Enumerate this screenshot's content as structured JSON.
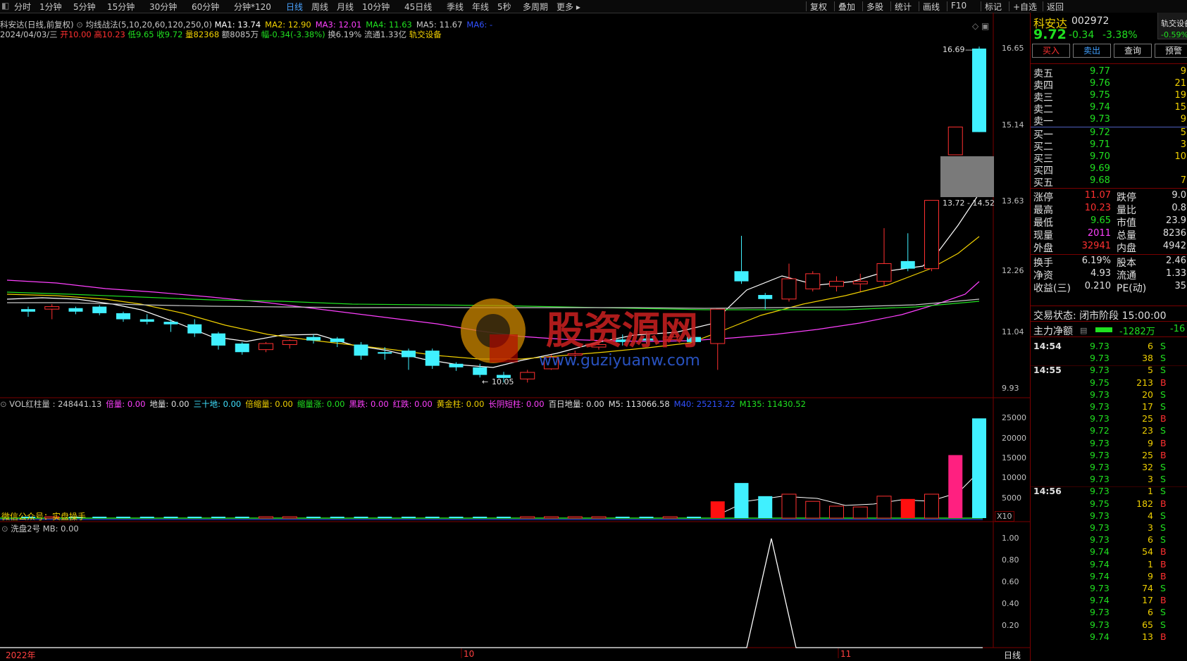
{
  "toolbar": {
    "tabs": [
      "分时",
      "1分钟",
      "5分钟",
      "15分钟",
      "30分钟",
      "60分钟",
      "分钟*120",
      "日线",
      "周线",
      "月线",
      "10分钟",
      "45日线",
      "季线",
      "年线",
      "5秒",
      "多周期",
      "更多 ▸"
    ],
    "active_tab": "日线",
    "right_buttons": [
      "复权",
      "叠加",
      "多股",
      "统计",
      "画线",
      "F10",
      "标记",
      "+自选",
      "返回"
    ]
  },
  "info": {
    "line1": {
      "stock": "科安达(日线,前复权)",
      "indicator": "均线战法(5,10,20,60,120,250,0)",
      "ma": [
        {
          "label": "MA1: 13.74",
          "color": "#ffffff"
        },
        {
          "label": "MA2: 12.90",
          "color": "#f0d000"
        },
        {
          "label": "MA3: 12.01",
          "color": "#ff40ff"
        },
        {
          "label": "MA4: 11.63",
          "color": "#20e020"
        },
        {
          "label": "MA5: 11.67",
          "color": "#c8c8c8"
        },
        {
          "label": "MA6: -",
          "color": "#3050ff"
        }
      ]
    },
    "line2": {
      "date": "2024/04/03/三",
      "open": "开10.00",
      "high": "高10.23",
      "low": "低9.65",
      "close": "收9.72",
      "vol": "量82368",
      "amount": "额8085万",
      "chg": "幅-0.34(-3.38%)",
      "turnover": "换6.19%",
      "float": "流通1.33亿",
      "sector": "轨交设备"
    }
  },
  "price_axis": [
    "16.65",
    "15.14",
    "13.63",
    "12.26",
    "11.04",
    "9.93"
  ],
  "price_notes": {
    "high_label": "16.69",
    "low_label": "10.05",
    "zone_label": "13.72 - 14.52"
  },
  "vol_header": [
    {
      "t": "VOL红柱量 : 248441.13",
      "c": "#c8c8c8"
    },
    {
      "t": "倍量: 0.00",
      "c": "#ff40ff"
    },
    {
      "t": "地量: 0.00",
      "c": "#e0e0e0"
    },
    {
      "t": "三十地: 0.00",
      "c": "#40e0ff"
    },
    {
      "t": "倍缩量: 0.00",
      "c": "#f0d000"
    },
    {
      "t": "缩量涨: 0.00",
      "c": "#20e020"
    },
    {
      "t": "黑跌: 0.00",
      "c": "#ff40ff"
    },
    {
      "t": "红跌: 0.00",
      "c": "#ff40ff"
    },
    {
      "t": "黄金柱: 0.00",
      "c": "#f0d000"
    },
    {
      "t": "长阴短柱: 0.00",
      "c": "#ff40ff"
    },
    {
      "t": "百日地量: 0.00",
      "c": "#e0e0e0"
    },
    {
      "t": "M5: 113066.58",
      "c": "#e0e0e0"
    },
    {
      "t": "M40: 25213.22",
      "c": "#3050ff"
    },
    {
      "t": "M135: 11430.52",
      "c": "#20e020"
    }
  ],
  "vol_axis": [
    "25000",
    "20000",
    "15000",
    "10000",
    "5000"
  ],
  "vol_unit": "X10",
  "vol_note": "微信公众号：实盘操手",
  "osc_header": "洗盘2号  MB: 0.00",
  "osc_axis": [
    "1.00",
    "0.80",
    "0.60",
    "0.40",
    "0.20"
  ],
  "time_axis": {
    "start": "2022年",
    "m1": "10",
    "m2": "11",
    "period": "日线"
  },
  "watermark": {
    "text": "股资源网",
    "url": "www.guziyuanw.com"
  },
  "quote": {
    "name": "科安达",
    "code": "002972",
    "price": "9.72",
    "chg": "-0.34",
    "pct": "-3.38%",
    "sector": "轨交设备",
    "sector_pct": "-0.59%",
    "buttons": [
      "买入",
      "卖出",
      "查询",
      "预警"
    ],
    "asks": [
      {
        "label": "卖五",
        "price": "9.77",
        "vol": "9"
      },
      {
        "label": "卖四",
        "price": "9.76",
        "vol": "21"
      },
      {
        "label": "卖三",
        "price": "9.75",
        "vol": "19"
      },
      {
        "label": "卖二",
        "price": "9.74",
        "vol": "15"
      },
      {
        "label": "卖一",
        "price": "9.73",
        "vol": "9"
      }
    ],
    "bids": [
      {
        "label": "买一",
        "price": "9.72",
        "vol": "5"
      },
      {
        "label": "买二",
        "price": "9.71",
        "vol": "3"
      },
      {
        "label": "买三",
        "price": "9.70",
        "vol": "10"
      },
      {
        "label": "买四",
        "price": "9.69",
        "vol": ""
      },
      {
        "label": "买五",
        "price": "9.68",
        "vol": "7"
      }
    ],
    "stats1": [
      {
        "l1": "涨停",
        "v1": "11.07",
        "c1": "#ff3030",
        "l2": "跌停",
        "v2": "9.0"
      },
      {
        "l1": "最高",
        "v1": "10.23",
        "c1": "#ff3030",
        "l2": "量比",
        "v2": "0.8"
      },
      {
        "l1": "最低",
        "v1": "9.65",
        "c1": "#20e020",
        "l2": "市值",
        "v2": "23.9"
      },
      {
        "l1": "现量",
        "v1": "2011",
        "c1": "#ff40ff",
        "l2": "总量",
        "v2": "8236"
      },
      {
        "l1": "外盘",
        "v1": "32941",
        "c1": "#ff3030",
        "l2": "内盘",
        "v2": "4942"
      }
    ],
    "stats2": [
      {
        "l1": "换手",
        "v1": "6.19%",
        "l2": "股本",
        "v2": "2.46"
      },
      {
        "l1": "净资",
        "v1": "4.93",
        "l2": "流通",
        "v2": "1.33"
      },
      {
        "l1": "收益(三)",
        "v1": "0.210",
        "l2": "PE(动)",
        "v2": "35"
      }
    ],
    "trade_state": "交易状态: 闭市阶段 15:00:00",
    "main_flow_label": "主力净额",
    "main_flow_val": "-1282万",
    "main_flow_val2": "-16"
  },
  "ticks": [
    {
      "t": "14:54",
      "p": "9.73",
      "v": "6",
      "s": "S"
    },
    {
      "t": "",
      "p": "9.73",
      "v": "38",
      "s": "S"
    },
    {
      "t": "14:55",
      "p": "9.73",
      "v": "5",
      "s": "S"
    },
    {
      "t": "",
      "p": "9.75",
      "v": "213",
      "s": "B"
    },
    {
      "t": "",
      "p": "9.73",
      "v": "20",
      "s": "S"
    },
    {
      "t": "",
      "p": "9.73",
      "v": "17",
      "s": "S"
    },
    {
      "t": "",
      "p": "9.73",
      "v": "25",
      "s": "B"
    },
    {
      "t": "",
      "p": "9.72",
      "v": "23",
      "s": "S"
    },
    {
      "t": "",
      "p": "9.73",
      "v": "9",
      "s": "B"
    },
    {
      "t": "",
      "p": "9.73",
      "v": "25",
      "s": "B"
    },
    {
      "t": "",
      "p": "9.73",
      "v": "32",
      "s": "S"
    },
    {
      "t": "",
      "p": "9.73",
      "v": "3",
      "s": "S"
    },
    {
      "t": "14:56",
      "p": "9.73",
      "v": "1",
      "s": "S"
    },
    {
      "t": "",
      "p": "9.75",
      "v": "182",
      "s": "B"
    },
    {
      "t": "",
      "p": "9.73",
      "v": "4",
      "s": "S"
    },
    {
      "t": "",
      "p": "9.73",
      "v": "3",
      "s": "S"
    },
    {
      "t": "",
      "p": "9.73",
      "v": "6",
      "s": "S"
    },
    {
      "t": "",
      "p": "9.74",
      "v": "54",
      "s": "B"
    },
    {
      "t": "",
      "p": "9.74",
      "v": "1",
      "s": "B"
    },
    {
      "t": "",
      "p": "9.74",
      "v": "9",
      "s": "B"
    },
    {
      "t": "",
      "p": "9.73",
      "v": "74",
      "s": "S"
    },
    {
      "t": "",
      "p": "9.74",
      "v": "17",
      "s": "B"
    },
    {
      "t": "",
      "p": "9.73",
      "v": "6",
      "s": "S"
    },
    {
      "t": "",
      "p": "9.73",
      "v": "65",
      "s": "S"
    },
    {
      "t": "",
      "p": "9.74",
      "v": "13",
      "s": "B"
    }
  ],
  "chart_data": {
    "type": "candlestick",
    "price_axis": [
      16.65,
      15.14,
      13.63,
      12.26,
      11.04,
      9.93
    ],
    "candles": [
      {
        "o": 11.5,
        "c": 11.45,
        "h": 11.55,
        "l": 11.35
      },
      {
        "o": 11.5,
        "c": 11.55,
        "h": 11.6,
        "l": 11.3
      },
      {
        "o": 11.52,
        "c": 11.45,
        "h": 11.55,
        "l": 11.4
      },
      {
        "o": 11.55,
        "c": 11.42,
        "h": 11.58,
        "l": 11.38
      },
      {
        "o": 11.42,
        "c": 11.3,
        "h": 11.45,
        "l": 11.25
      },
      {
        "o": 11.3,
        "c": 11.25,
        "h": 11.4,
        "l": 11.2
      },
      {
        "o": 11.25,
        "c": 11.2,
        "h": 11.3,
        "l": 11.05
      },
      {
        "o": 11.2,
        "c": 11.02,
        "h": 11.3,
        "l": 10.95
      },
      {
        "o": 11.02,
        "c": 10.78,
        "h": 11.05,
        "l": 10.7
      },
      {
        "o": 10.82,
        "c": 10.65,
        "h": 10.85,
        "l": 10.6
      },
      {
        "o": 10.7,
        "c": 10.82,
        "h": 10.85,
        "l": 10.65
      },
      {
        "o": 10.8,
        "c": 10.88,
        "h": 10.9,
        "l": 10.72
      },
      {
        "o": 10.95,
        "c": 10.88,
        "h": 11.0,
        "l": 10.82
      },
      {
        "o": 10.92,
        "c": 10.85,
        "h": 10.95,
        "l": 10.75
      },
      {
        "o": 10.8,
        "c": 10.58,
        "h": 10.85,
        "l": 10.5
      },
      {
        "o": 10.65,
        "c": 10.62,
        "h": 10.75,
        "l": 10.5
      },
      {
        "o": 10.68,
        "c": 10.55,
        "h": 10.72,
        "l": 10.3
      },
      {
        "o": 10.68,
        "c": 10.38,
        "h": 10.72,
        "l": 10.32
      },
      {
        "o": 10.42,
        "c": 10.35,
        "h": 10.45,
        "l": 10.28
      },
      {
        "o": 10.35,
        "c": 10.2,
        "h": 10.42,
        "l": 10.15
      },
      {
        "o": 10.2,
        "c": 10.14,
        "h": 10.26,
        "l": 10.05
      },
      {
        "o": 10.12,
        "c": 10.25,
        "h": 10.3,
        "l": 10.05
      },
      {
        "o": 10.32,
        "c": 10.55,
        "h": 10.6,
        "l": 10.3
      },
      {
        "o": 10.6,
        "c": 10.62,
        "h": 10.68,
        "l": 10.5
      },
      {
        "o": 10.75,
        "c": 10.8,
        "h": 10.85,
        "l": 10.7
      },
      {
        "o": 10.9,
        "c": 10.85,
        "h": 11.0,
        "l": 10.78
      },
      {
        "o": 10.92,
        "c": 10.88,
        "h": 11.05,
        "l": 10.82
      },
      {
        "o": 10.9,
        "c": 10.95,
        "h": 11.0,
        "l": 10.85
      },
      {
        "o": 10.95,
        "c": 10.85,
        "h": 11.0,
        "l": 10.8
      },
      {
        "o": 10.82,
        "c": 11.5,
        "h": 11.5,
        "l": 10.3
      },
      {
        "o": 12.25,
        "c": 12.05,
        "h": 12.95,
        "l": 12.0
      },
      {
        "o": 11.78,
        "c": 11.7,
        "h": 11.82,
        "l": 11.5
      },
      {
        "o": 11.7,
        "c": 12.1,
        "h": 12.4,
        "l": 11.65
      },
      {
        "o": 11.9,
        "c": 12.2,
        "h": 12.25,
        "l": 11.85
      },
      {
        "o": 11.95,
        "c": 12.05,
        "h": 12.15,
        "l": 11.85
      },
      {
        "o": 12.0,
        "c": 12.05,
        "h": 12.2,
        "l": 11.85
      },
      {
        "o": 12.05,
        "c": 12.4,
        "h": 13.1,
        "l": 11.95
      },
      {
        "o": 12.45,
        "c": 12.3,
        "h": 13.0,
        "l": 12.25
      },
      {
        "o": 12.3,
        "c": 13.65,
        "h": 13.65,
        "l": 12.25
      },
      {
        "o": 14.55,
        "c": 15.1,
        "h": 15.1,
        "l": 14.55
      },
      {
        "o": 16.65,
        "c": 15.0,
        "h": 16.69,
        "l": 15.0
      }
    ]
  }
}
